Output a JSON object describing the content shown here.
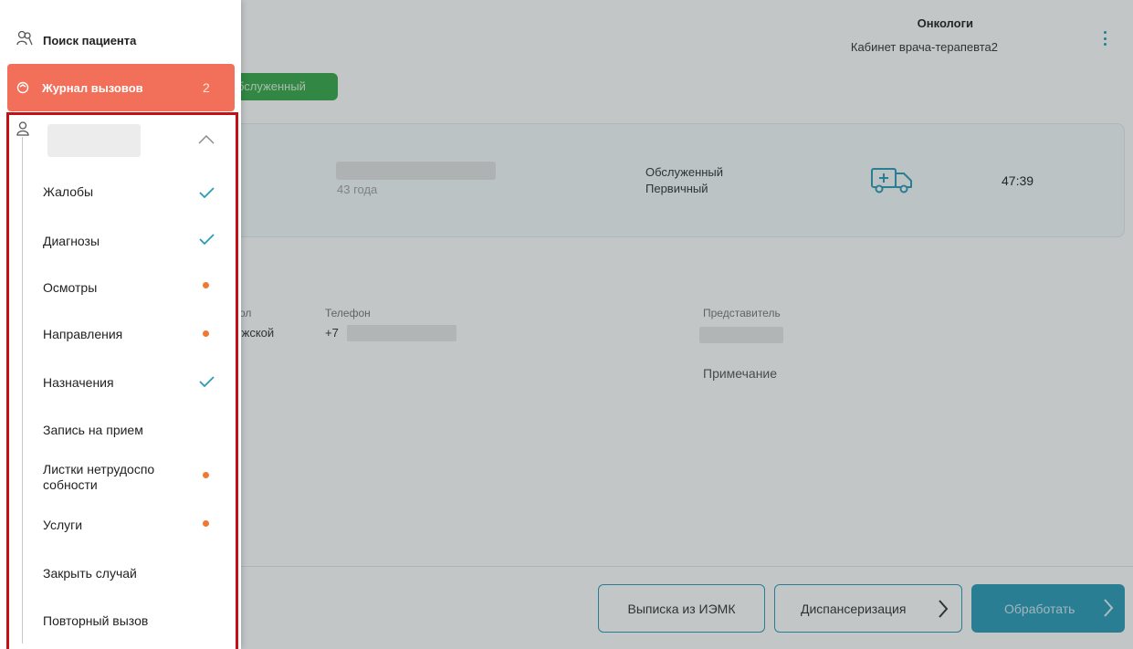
{
  "header": {
    "department": "Онкологи",
    "cabinet": "Кабинет врача-терапевта2"
  },
  "status_chip": "бслуженный",
  "call_card": {
    "age": "43 года",
    "status": "Обслуженный",
    "visit_type": "Первичный",
    "timer": "47:39"
  },
  "patient_info": {
    "sex_label": "ол",
    "sex_value": "ужской",
    "phone_label": "Телефон",
    "phone_value": "+7",
    "representative_label": "Представитель",
    "note_label": "Примечание"
  },
  "footer": {
    "iemk_button": "Выписка из ИЭМК",
    "dispensary_button": "Диспансеризация",
    "process_button": "Обработать"
  },
  "drawer": {
    "search_label": "Поиск пациента",
    "journal_label": "Журнал вызовов",
    "journal_count": "2",
    "items": [
      {
        "label": "Жалобы",
        "status": "check"
      },
      {
        "label": "Диагнозы",
        "status": "check"
      },
      {
        "label": "Осмотры",
        "status": "dot"
      },
      {
        "label": "Направления",
        "status": "dot"
      },
      {
        "label": "Назначения",
        "status": "check"
      },
      {
        "label": "Запись на прием",
        "status": "none"
      },
      {
        "label": "Листки нетрудоспо собности",
        "status": "dot"
      },
      {
        "label": "Услуги",
        "status": "dot"
      },
      {
        "label": "Закрыть случай",
        "status": "none"
      },
      {
        "label": "Повторный вызов",
        "status": "none"
      }
    ]
  },
  "colors": {
    "accent": "#2a9bb8",
    "journal_bg": "#f2705a",
    "status_green": "#36a84a",
    "dot_orange": "#f07830",
    "highlight_red": "#c40f16"
  },
  "icons": {
    "search": "patient-search-icon",
    "journal": "call-journal-icon",
    "patient": "person-icon",
    "collapse": "chevron-up-icon",
    "done": "check-icon",
    "pending": "dot-icon",
    "ambulance": "ambulance-icon",
    "menu": "kebab-menu-icon"
  }
}
